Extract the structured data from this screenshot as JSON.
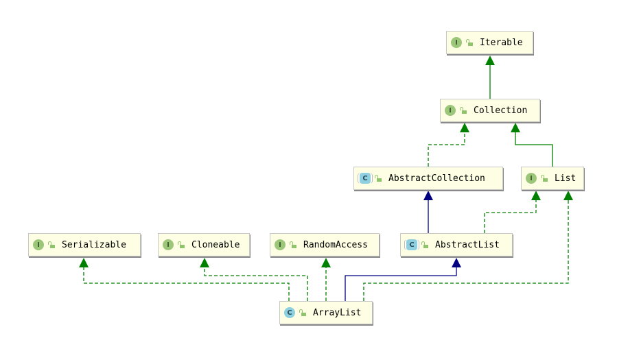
{
  "nodes": {
    "iterable": {
      "name": "Iterable",
      "kind": "interface"
    },
    "collection": {
      "name": "Collection",
      "kind": "interface"
    },
    "abstract_collection": {
      "name": "AbstractCollection",
      "kind": "abstract-class"
    },
    "list": {
      "name": "List",
      "kind": "interface"
    },
    "serializable": {
      "name": "Serializable",
      "kind": "interface"
    },
    "cloneable": {
      "name": "Cloneable",
      "kind": "interface"
    },
    "random_access": {
      "name": "RandomAccess",
      "kind": "interface"
    },
    "abstract_list": {
      "name": "AbstractList",
      "kind": "abstract-class"
    },
    "array_list": {
      "name": "ArrayList",
      "kind": "class"
    }
  },
  "kind_letters": {
    "interface": "I",
    "class": "C"
  },
  "edges": [
    {
      "from": "Collection",
      "to": "Iterable",
      "type": "extends"
    },
    {
      "from": "AbstractCollection",
      "to": "Collection",
      "type": "implements"
    },
    {
      "from": "List",
      "to": "Collection",
      "type": "extends"
    },
    {
      "from": "AbstractList",
      "to": "AbstractCollection",
      "type": "class-extends"
    },
    {
      "from": "AbstractList",
      "to": "List",
      "type": "implements"
    },
    {
      "from": "ArrayList",
      "to": "List",
      "type": "implements"
    },
    {
      "from": "ArrayList",
      "to": "AbstractList",
      "type": "class-extends"
    },
    {
      "from": "ArrayList",
      "to": "RandomAccess",
      "type": "implements"
    },
    {
      "from": "ArrayList",
      "to": "Cloneable",
      "type": "implements"
    },
    {
      "from": "ArrayList",
      "to": "Serializable",
      "type": "implements"
    }
  ],
  "colors": {
    "interface_edge": "#008000",
    "class_edge": "#000080",
    "node_fill": "#fefee4"
  }
}
